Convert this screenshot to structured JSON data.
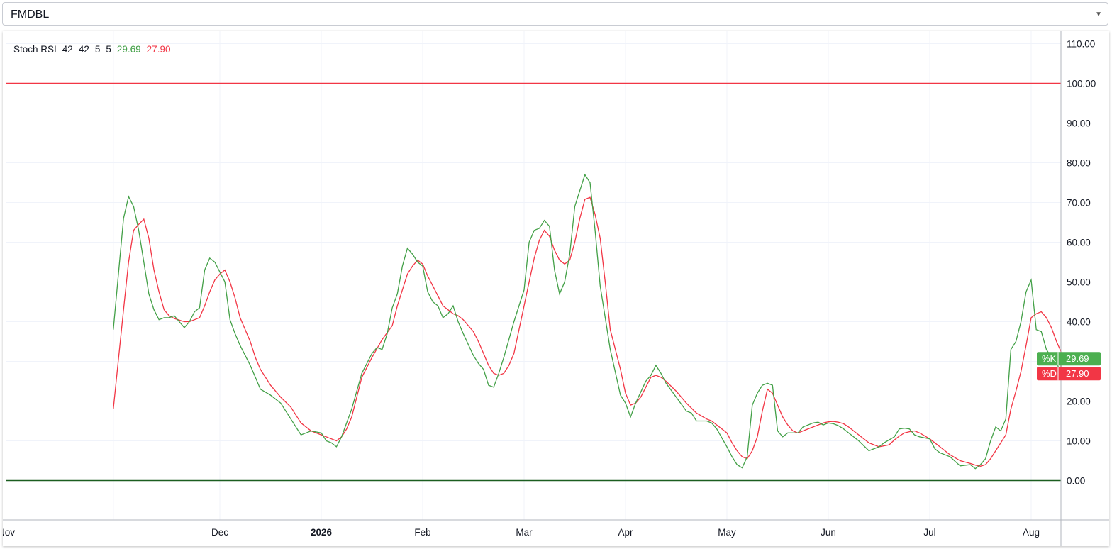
{
  "symbol_selector": {
    "value": "FMDBL",
    "icon": "chevron-down-icon"
  },
  "chart_data": {
    "type": "line",
    "indicator": "Stoch RSI",
    "params": [
      "42",
      "42",
      "5",
      "5"
    ],
    "k_value": "29.69",
    "d_value": "27.90",
    "k_label": "%K",
    "d_label": "%D",
    "colors": {
      "k": "#43a047",
      "d": "#f23645",
      "upper_band": "#f23645",
      "lower_band": "#1b5e20"
    },
    "ylim": [
      -10,
      112
    ],
    "y_ticks": [
      "110.00",
      "100.00",
      "90.00",
      "80.00",
      "70.00",
      "60.00",
      "50.00",
      "40.00",
      "30.00",
      "20.00",
      "10.00",
      "0.00"
    ],
    "bands": {
      "upper": 100,
      "lower": 0
    },
    "x_ticks": [
      {
        "label": "Nov",
        "x": -0.05
      },
      {
        "label": "Dec",
        "x": 1
      },
      {
        "label": "2026",
        "x": 2,
        "bold": true
      },
      {
        "label": "Feb",
        "x": 3
      },
      {
        "label": "Mar",
        "x": 4
      },
      {
        "label": "Apr",
        "x": 5
      },
      {
        "label": "May",
        "x": 6
      },
      {
        "label": "Jun",
        "x": 7
      },
      {
        "label": "Jul",
        "x": 8
      },
      {
        "label": "Aug",
        "x": 9
      }
    ],
    "x_range": [
      -0.05,
      10.05
    ],
    "k_series": [
      [
        -0.05,
        38
      ],
      [
        0.05,
        66
      ],
      [
        0.1,
        71.5
      ],
      [
        0.15,
        69
      ],
      [
        0.2,
        63
      ],
      [
        0.25,
        55
      ],
      [
        0.3,
        47
      ],
      [
        0.35,
        43
      ],
      [
        0.4,
        40.5
      ],
      [
        0.45,
        41
      ],
      [
        0.5,
        41
      ],
      [
        0.55,
        41.5
      ],
      [
        0.6,
        40
      ],
      [
        0.65,
        38.5
      ],
      [
        0.7,
        40
      ],
      [
        0.75,
        42.5
      ],
      [
        0.8,
        43.5
      ],
      [
        0.85,
        53
      ],
      [
        0.9,
        56
      ],
      [
        0.95,
        55
      ],
      [
        1.0,
        52.5
      ],
      [
        1.05,
        50
      ],
      [
        1.1,
        40.5
      ],
      [
        1.15,
        37
      ],
      [
        1.2,
        34
      ],
      [
        1.3,
        29
      ],
      [
        1.35,
        26
      ],
      [
        1.4,
        23
      ],
      [
        1.5,
        21.5
      ],
      [
        1.6,
        19.5
      ],
      [
        1.7,
        15.5
      ],
      [
        1.8,
        11.5
      ],
      [
        1.9,
        12.5
      ],
      [
        2.0,
        12
      ],
      [
        2.05,
        10
      ],
      [
        2.1,
        9.5
      ],
      [
        2.15,
        8.5
      ],
      [
        2.2,
        11
      ],
      [
        2.3,
        18
      ],
      [
        2.4,
        27
      ],
      [
        2.5,
        32
      ],
      [
        2.55,
        33.5
      ],
      [
        2.6,
        33
      ],
      [
        2.65,
        37
      ],
      [
        2.7,
        43.5
      ],
      [
        2.75,
        47
      ],
      [
        2.8,
        54
      ],
      [
        2.85,
        58.5
      ],
      [
        2.9,
        57
      ],
      [
        2.95,
        55
      ],
      [
        3.0,
        54
      ],
      [
        3.05,
        47.5
      ],
      [
        3.1,
        45
      ],
      [
        3.15,
        44
      ],
      [
        3.2,
        41
      ],
      [
        3.25,
        42
      ],
      [
        3.3,
        44
      ],
      [
        3.35,
        40
      ],
      [
        3.4,
        37
      ],
      [
        3.5,
        31.5
      ],
      [
        3.55,
        29.5
      ],
      [
        3.6,
        28
      ],
      [
        3.65,
        24
      ],
      [
        3.7,
        23.5
      ],
      [
        3.75,
        27
      ],
      [
        3.8,
        31
      ],
      [
        3.9,
        40
      ],
      [
        4.0,
        48
      ],
      [
        4.05,
        60
      ],
      [
        4.1,
        63
      ],
      [
        4.15,
        63.5
      ],
      [
        4.2,
        65.5
      ],
      [
        4.25,
        64
      ],
      [
        4.3,
        53
      ],
      [
        4.35,
        47
      ],
      [
        4.4,
        50
      ],
      [
        4.45,
        57
      ],
      [
        4.5,
        69
      ],
      [
        4.55,
        73
      ],
      [
        4.6,
        77
      ],
      [
        4.65,
        75
      ],
      [
        4.7,
        63
      ],
      [
        4.75,
        49
      ],
      [
        4.8,
        41
      ],
      [
        4.85,
        33
      ],
      [
        4.95,
        21.5
      ],
      [
        5.0,
        19.5
      ],
      [
        5.05,
        16
      ],
      [
        5.1,
        19.5
      ],
      [
        5.2,
        25
      ],
      [
        5.25,
        26.5
      ],
      [
        5.3,
        29
      ],
      [
        5.35,
        27
      ],
      [
        5.4,
        24.5
      ],
      [
        5.5,
        21
      ],
      [
        5.6,
        17.5
      ],
      [
        5.65,
        17
      ],
      [
        5.7,
        15
      ],
      [
        5.8,
        15
      ],
      [
        5.85,
        14.5
      ],
      [
        5.9,
        13
      ],
      [
        6.0,
        8.5
      ],
      [
        6.05,
        6
      ],
      [
        6.1,
        4
      ],
      [
        6.15,
        3.2
      ],
      [
        6.2,
        6
      ],
      [
        6.25,
        19
      ],
      [
        6.3,
        22
      ],
      [
        6.35,
        24
      ],
      [
        6.4,
        24.5
      ],
      [
        6.45,
        24
      ],
      [
        6.5,
        12.5
      ],
      [
        6.55,
        11
      ],
      [
        6.6,
        12
      ],
      [
        6.7,
        12
      ],
      [
        6.75,
        13.5
      ],
      [
        6.85,
        14.5
      ],
      [
        6.9,
        14.7
      ],
      [
        6.95,
        14
      ],
      [
        7.0,
        14.5
      ],
      [
        7.05,
        14.3
      ],
      [
        7.1,
        13.8
      ],
      [
        7.15,
        13
      ],
      [
        7.2,
        12
      ],
      [
        7.3,
        10
      ],
      [
        7.4,
        7.5
      ],
      [
        7.5,
        8.5
      ],
      [
        7.55,
        9.5
      ],
      [
        7.65,
        11
      ],
      [
        7.7,
        13
      ],
      [
        7.75,
        13.2
      ],
      [
        7.8,
        13
      ],
      [
        7.85,
        11.5
      ],
      [
        7.9,
        11
      ],
      [
        8.0,
        10.5
      ],
      [
        8.05,
        8
      ],
      [
        8.1,
        7
      ],
      [
        8.2,
        6
      ],
      [
        8.3,
        3.7
      ],
      [
        8.4,
        4
      ],
      [
        8.45,
        3
      ],
      [
        8.5,
        4
      ],
      [
        8.55,
        5.5
      ],
      [
        8.6,
        10
      ],
      [
        8.65,
        13.5
      ],
      [
        8.7,
        12.5
      ],
      [
        8.75,
        15.5
      ],
      [
        8.8,
        33
      ],
      [
        8.85,
        35
      ],
      [
        8.9,
        40
      ],
      [
        8.95,
        47.5
      ],
      [
        9.0,
        50.5
      ],
      [
        9.05,
        38
      ],
      [
        9.1,
        37.5
      ],
      [
        9.15,
        33
      ],
      [
        9.2,
        31
      ],
      [
        9.25,
        30
      ],
      [
        9.3,
        26.5
      ],
      [
        9.35,
        25.5
      ],
      [
        9.4,
        27
      ],
      [
        9.45,
        27.5
      ],
      [
        9.55,
        27.5
      ],
      [
        9.6,
        29.69
      ]
    ],
    "d_series": [
      [
        -0.05,
        18
      ],
      [
        0.05,
        43
      ],
      [
        0.1,
        55
      ],
      [
        0.15,
        63
      ],
      [
        0.2,
        64.5
      ],
      [
        0.25,
        65.8
      ],
      [
        0.3,
        61
      ],
      [
        0.35,
        53
      ],
      [
        0.4,
        47.5
      ],
      [
        0.45,
        43
      ],
      [
        0.5,
        41.5
      ],
      [
        0.55,
        40.8
      ],
      [
        0.6,
        40.4
      ],
      [
        0.65,
        40
      ],
      [
        0.7,
        40
      ],
      [
        0.75,
        40.5
      ],
      [
        0.8,
        41
      ],
      [
        0.85,
        44
      ],
      [
        0.9,
        47.5
      ],
      [
        0.95,
        50.5
      ],
      [
        1.0,
        52
      ],
      [
        1.05,
        53
      ],
      [
        1.1,
        50
      ],
      [
        1.15,
        46
      ],
      [
        1.2,
        41
      ],
      [
        1.3,
        35
      ],
      [
        1.35,
        31
      ],
      [
        1.4,
        28
      ],
      [
        1.5,
        24
      ],
      [
        1.6,
        21
      ],
      [
        1.7,
        18.5
      ],
      [
        1.8,
        14.5
      ],
      [
        1.9,
        12.5
      ],
      [
        2.0,
        11.5
      ],
      [
        2.1,
        10.5
      ],
      [
        2.15,
        10
      ],
      [
        2.2,
        11
      ],
      [
        2.25,
        13
      ],
      [
        2.3,
        16
      ],
      [
        2.4,
        26
      ],
      [
        2.5,
        31
      ],
      [
        2.6,
        35.5
      ],
      [
        2.7,
        39
      ],
      [
        2.75,
        44
      ],
      [
        2.8,
        48
      ],
      [
        2.85,
        52
      ],
      [
        2.9,
        54
      ],
      [
        2.95,
        55.5
      ],
      [
        3.0,
        54.5
      ],
      [
        3.05,
        51.5
      ],
      [
        3.1,
        49
      ],
      [
        3.15,
        46.5
      ],
      [
        3.2,
        44
      ],
      [
        3.25,
        43
      ],
      [
        3.3,
        42
      ],
      [
        3.35,
        41.5
      ],
      [
        3.4,
        40.5
      ],
      [
        3.5,
        37.5
      ],
      [
        3.55,
        35
      ],
      [
        3.6,
        32
      ],
      [
        3.65,
        29
      ],
      [
        3.7,
        27
      ],
      [
        3.75,
        26.5
      ],
      [
        3.8,
        27
      ],
      [
        3.85,
        29
      ],
      [
        3.9,
        32
      ],
      [
        4.0,
        44
      ],
      [
        4.05,
        50
      ],
      [
        4.1,
        56
      ],
      [
        4.15,
        60.5
      ],
      [
        4.2,
        63
      ],
      [
        4.25,
        61.5
      ],
      [
        4.3,
        58
      ],
      [
        4.35,
        55.5
      ],
      [
        4.4,
        54.5
      ],
      [
        4.45,
        55.5
      ],
      [
        4.5,
        60
      ],
      [
        4.55,
        66
      ],
      [
        4.6,
        70.8
      ],
      [
        4.65,
        71.3
      ],
      [
        4.7,
        67
      ],
      [
        4.75,
        61
      ],
      [
        4.8,
        50
      ],
      [
        4.85,
        38
      ],
      [
        4.95,
        28
      ],
      [
        5.0,
        22
      ],
      [
        5.05,
        19
      ],
      [
        5.1,
        19.5
      ],
      [
        5.15,
        21
      ],
      [
        5.2,
        23.5
      ],
      [
        5.25,
        26
      ],
      [
        5.3,
        26.5
      ],
      [
        5.35,
        26
      ],
      [
        5.4,
        25
      ],
      [
        5.5,
        22.5
      ],
      [
        5.6,
        19.5
      ],
      [
        5.7,
        17
      ],
      [
        5.8,
        15.5
      ],
      [
        5.85,
        15
      ],
      [
        5.9,
        14
      ],
      [
        6.0,
        12
      ],
      [
        6.05,
        9.5
      ],
      [
        6.1,
        7.5
      ],
      [
        6.15,
        6
      ],
      [
        6.2,
        5.5
      ],
      [
        6.25,
        7.5
      ],
      [
        6.3,
        11
      ],
      [
        6.35,
        17.5
      ],
      [
        6.4,
        23
      ],
      [
        6.45,
        22
      ],
      [
        6.5,
        19
      ],
      [
        6.55,
        16
      ],
      [
        6.6,
        14
      ],
      [
        6.65,
        12.5
      ],
      [
        6.7,
        12
      ],
      [
        6.75,
        12.5
      ],
      [
        6.85,
        13.5
      ],
      [
        6.9,
        14
      ],
      [
        6.95,
        14.5
      ],
      [
        7.0,
        14.8
      ],
      [
        7.05,
        14.9
      ],
      [
        7.1,
        14.7
      ],
      [
        7.15,
        14.3
      ],
      [
        7.2,
        13.5
      ],
      [
        7.3,
        11.5
      ],
      [
        7.4,
        9.5
      ],
      [
        7.5,
        8.5
      ],
      [
        7.6,
        9
      ],
      [
        7.65,
        10.2
      ],
      [
        7.7,
        11.2
      ],
      [
        7.75,
        12
      ],
      [
        7.8,
        12.3
      ],
      [
        7.85,
        12.5
      ],
      [
        7.9,
        12
      ],
      [
        8.0,
        10.5
      ],
      [
        8.05,
        9.5
      ],
      [
        8.1,
        8.5
      ],
      [
        8.2,
        6.5
      ],
      [
        8.3,
        5
      ],
      [
        8.4,
        4.3
      ],
      [
        8.45,
        3.9
      ],
      [
        8.5,
        3.6
      ],
      [
        8.55,
        4
      ],
      [
        8.6,
        5.5
      ],
      [
        8.65,
        7.5
      ],
      [
        8.7,
        9.5
      ],
      [
        8.75,
        11.5
      ],
      [
        8.8,
        18
      ],
      [
        8.85,
        22.5
      ],
      [
        8.9,
        27.5
      ],
      [
        8.95,
        34
      ],
      [
        9.0,
        41
      ],
      [
        9.05,
        42
      ],
      [
        9.1,
        42.5
      ],
      [
        9.15,
        41
      ],
      [
        9.2,
        38.5
      ],
      [
        9.25,
        35
      ],
      [
        9.3,
        32.5
      ],
      [
        9.35,
        29.5
      ],
      [
        9.4,
        28
      ],
      [
        9.45,
        27.5
      ],
      [
        9.55,
        27
      ],
      [
        9.6,
        27.9
      ]
    ]
  }
}
